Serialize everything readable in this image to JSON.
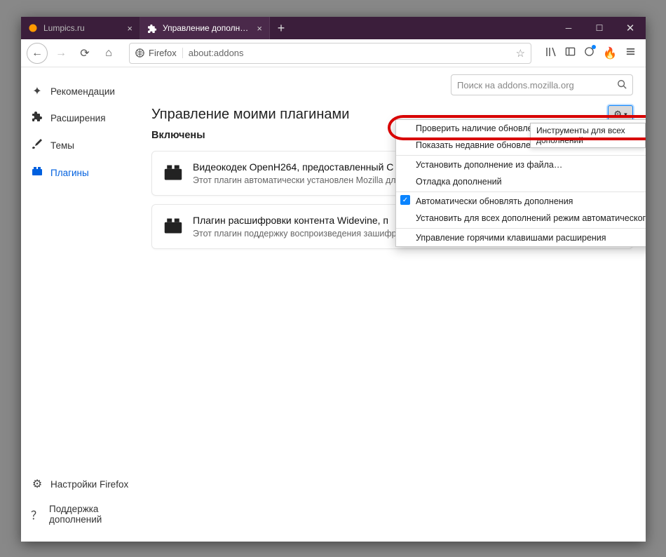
{
  "tabs": [
    {
      "label": "Lumpics.ru",
      "favicon_color": "#ff9a00"
    },
    {
      "label": "Управление дополнениями"
    }
  ],
  "urlbar": {
    "identity": "Firefox",
    "address": "about:addons"
  },
  "search": {
    "placeholder": "Поиск на addons.mozilla.org"
  },
  "page": {
    "title": "Управление моими плагинами",
    "section": "Включены"
  },
  "sidebar": {
    "items": [
      {
        "label": "Рекомендации"
      },
      {
        "label": "Расширения"
      },
      {
        "label": "Темы"
      },
      {
        "label": "Плагины"
      }
    ],
    "footer": [
      {
        "label": "Настройки Firefox"
      },
      {
        "label": "Поддержка дополнений"
      }
    ]
  },
  "plugins": [
    {
      "title": "Видеокодек OpenH264, предоставленный C",
      "desc": "Этот плагин автоматически установлен Mozilla для"
    },
    {
      "title": "Плагин расшифровки контента Widevine, п",
      "desc": "Этот плагин поддержку воспроизведения зашифрованного медиа в соответс…"
    }
  ],
  "menu": {
    "items": [
      "Проверить наличие обновлений",
      "Показать недавние обновления",
      "Установить дополнение из файла…",
      "Отладка дополнений",
      "Автоматически обновлять дополнения",
      "Установить для всех дополнений режим автоматического обновления",
      "Управление горячими клавишами расширения"
    ],
    "tooltip": "Инструменты для всех дополнений"
  }
}
